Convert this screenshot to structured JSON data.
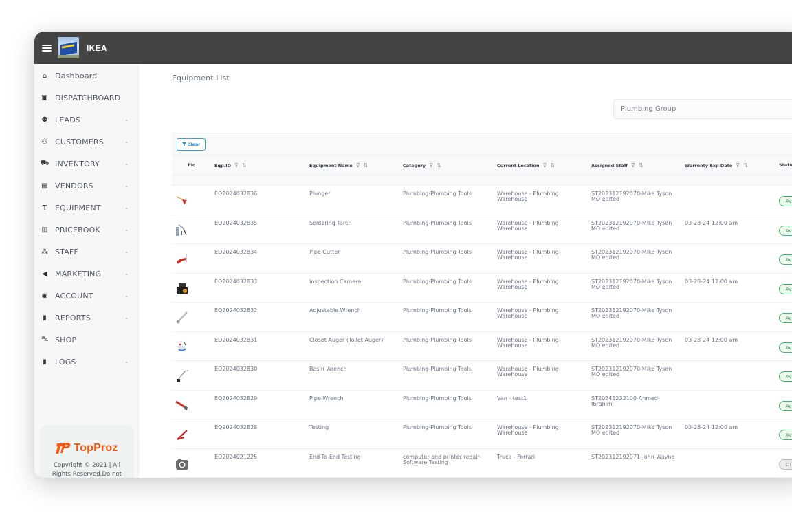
{
  "app": {
    "brand": "IKEA",
    "menu_icon": "hamburger-icon",
    "logo_image": "store-building-photo"
  },
  "sidebar": {
    "items": [
      {
        "label": "Dashboard",
        "icon": "home-icon",
        "glyph": "⌂",
        "has_chevron": false
      },
      {
        "label": "DISPATCHBOARD",
        "icon": "clipboard-icon",
        "glyph": "▣",
        "has_chevron": false
      },
      {
        "label": "LEADS",
        "icon": "user-icon",
        "glyph": "⚉",
        "has_chevron": true
      },
      {
        "label": "CUSTOMERS",
        "icon": "users-icon",
        "glyph": "⚇",
        "has_chevron": true
      },
      {
        "label": "INVENTORY",
        "icon": "truck-icon",
        "glyph": "⛟",
        "has_chevron": true
      },
      {
        "label": "VENDORS",
        "icon": "store-icon",
        "glyph": "▤",
        "has_chevron": true
      },
      {
        "label": "EQUIPMENT",
        "icon": "drill-icon",
        "glyph": "T",
        "has_chevron": true
      },
      {
        "label": "PRICEBOOK",
        "icon": "book-icon",
        "glyph": "▥",
        "has_chevron": true
      },
      {
        "label": "STAFF",
        "icon": "team-icon",
        "glyph": "⁂",
        "has_chevron": true
      },
      {
        "label": "MARKETING",
        "icon": "megaphone-icon",
        "glyph": "◀",
        "has_chevron": true
      },
      {
        "label": "ACCOUNT",
        "icon": "account-circle-icon",
        "glyph": "◉",
        "has_chevron": true
      },
      {
        "label": "REPORTS",
        "icon": "bar-chart-icon",
        "glyph": "▮",
        "has_chevron": true
      },
      {
        "label": "SHOP",
        "icon": "cart-icon",
        "glyph": "⛍",
        "has_chevron": false
      },
      {
        "label": "LOGS",
        "icon": "file-icon",
        "glyph": "▮",
        "has_chevron": true
      }
    ],
    "chevron_glyph": "⌄",
    "footer": {
      "logo_text": "TopProz",
      "logo_color": "#f25a12",
      "copyright": "Copyright © 2021 | All Rights Reserved.Do not copy, duplicate or distribute any of this content without a written"
    }
  },
  "main": {
    "title": "Equipment List",
    "group_select": {
      "value": "Plumbing Group"
    },
    "clear_button": {
      "label": "Clear",
      "icon": "filter-icon"
    },
    "columns": [
      {
        "label": "Pic",
        "filter": false,
        "sort": false
      },
      {
        "label": "Eqp.ID",
        "filter": true,
        "sort": true
      },
      {
        "label": "Equipment Name",
        "filter": true,
        "sort": true
      },
      {
        "label": "Category",
        "filter": true,
        "sort": true
      },
      {
        "label": "Current Location",
        "filter": true,
        "sort": true
      },
      {
        "label": "Assigned Staff",
        "filter": true,
        "sort": true
      },
      {
        "label": "Warrenty Exp Date",
        "filter": true,
        "sort": true
      },
      {
        "label": "Status",
        "filter": false,
        "sort": false
      }
    ],
    "filter_glyph": "⊽",
    "sort_glyph": "⇅",
    "rows": [
      {
        "pic": "plunger",
        "id": "EQ2024032836",
        "name": "Plunger",
        "category": "Plumbing-Plumbing Tools",
        "location": "Warehouse - Plumbing Warehouse",
        "staff": "ST202312192070-Mike Tyson MO edited",
        "warranty": "",
        "status": "Av",
        "status_kind": "available"
      },
      {
        "pic": "soldering-torch",
        "id": "EQ2024032835",
        "name": "Soldering Torch",
        "category": "Plumbing-Plumbing Tools",
        "location": "Warehouse - Plumbing Warehouse",
        "staff": "ST202312192070-Mike Tyson MO edited",
        "warranty": "03-28-24 12:00 am",
        "status": "Av",
        "status_kind": "available"
      },
      {
        "pic": "pipe-cutter",
        "id": "EQ2024032834",
        "name": "Pipe Cutter",
        "category": "Plumbing-Plumbing Tools",
        "location": "Warehouse - Plumbing Warehouse",
        "staff": "ST202312192070-Mike Tyson MO edited",
        "warranty": "",
        "status": "Av",
        "status_kind": "available"
      },
      {
        "pic": "inspection-camera",
        "id": "EQ2024032833",
        "name": "Inspection Camera",
        "category": "Plumbing-Plumbing Tools",
        "location": "Warehouse - Plumbing Warehouse",
        "staff": "ST202312192070-Mike Tyson MO edited",
        "warranty": "03-28-24 12:00 am",
        "status": "Av",
        "status_kind": "available"
      },
      {
        "pic": "adjustable-wrench",
        "id": "EQ2024032832",
        "name": "Adjustable Wrench",
        "category": "Plumbing-Plumbing Tools",
        "location": "Warehouse - Plumbing Warehouse",
        "staff": "ST202312192070-Mike Tyson MO edited",
        "warranty": "",
        "status": "Av",
        "status_kind": "available"
      },
      {
        "pic": "closet-auger",
        "id": "EQ2024032831",
        "name": "Closet Auger (Toilet Auger)",
        "category": "Plumbing-Plumbing Tools",
        "location": "Warehouse - Plumbing Warehouse",
        "staff": "ST202312192070-Mike Tyson MO edited",
        "warranty": "03-28-24 12:00 am",
        "status": "Av",
        "status_kind": "available"
      },
      {
        "pic": "basin-wrench",
        "id": "EQ2024032830",
        "name": "Basin Wrench",
        "category": "Plumbing-Plumbing Tools",
        "location": "Warehouse - Plumbing Warehouse",
        "staff": "ST202312192070-Mike Tyson MO edited",
        "warranty": "",
        "status": "Av",
        "status_kind": "available"
      },
      {
        "pic": "pipe-wrench",
        "id": "EQ2024032829",
        "name": "Pipe Wrench",
        "category": "Plumbing-Plumbing Tools",
        "location": "Van - test1",
        "staff": "ST20241232100-Ahmed-Ibrahim",
        "warranty": "",
        "status": "Av",
        "status_kind": "available"
      },
      {
        "pic": "red-tool",
        "id": "EQ2024032828",
        "name": "Testing",
        "category": "Plumbing-Plumbing Tools",
        "location": "Warehouse - Plumbing Warehouse",
        "staff": "ST202312192070-Mike Tyson MO edited",
        "warranty": "03-28-24 12:00 am",
        "status": "Av",
        "status_kind": "available"
      },
      {
        "pic": "camera-placeholder",
        "id": "EQ2024021225",
        "name": "End-To-End Testing",
        "category": "computer and printer repair-Software Testing",
        "location": "Truck - Ferrari",
        "staff": "ST202312192071-John-Wayne",
        "warranty": "",
        "status": "Di",
        "status_kind": "disabled"
      }
    ]
  },
  "colors": {
    "topbar": "#444444",
    "accent_blue": "#2b8fd8",
    "status_available": "#47b36a",
    "status_disabled": "#b7b9bd"
  }
}
